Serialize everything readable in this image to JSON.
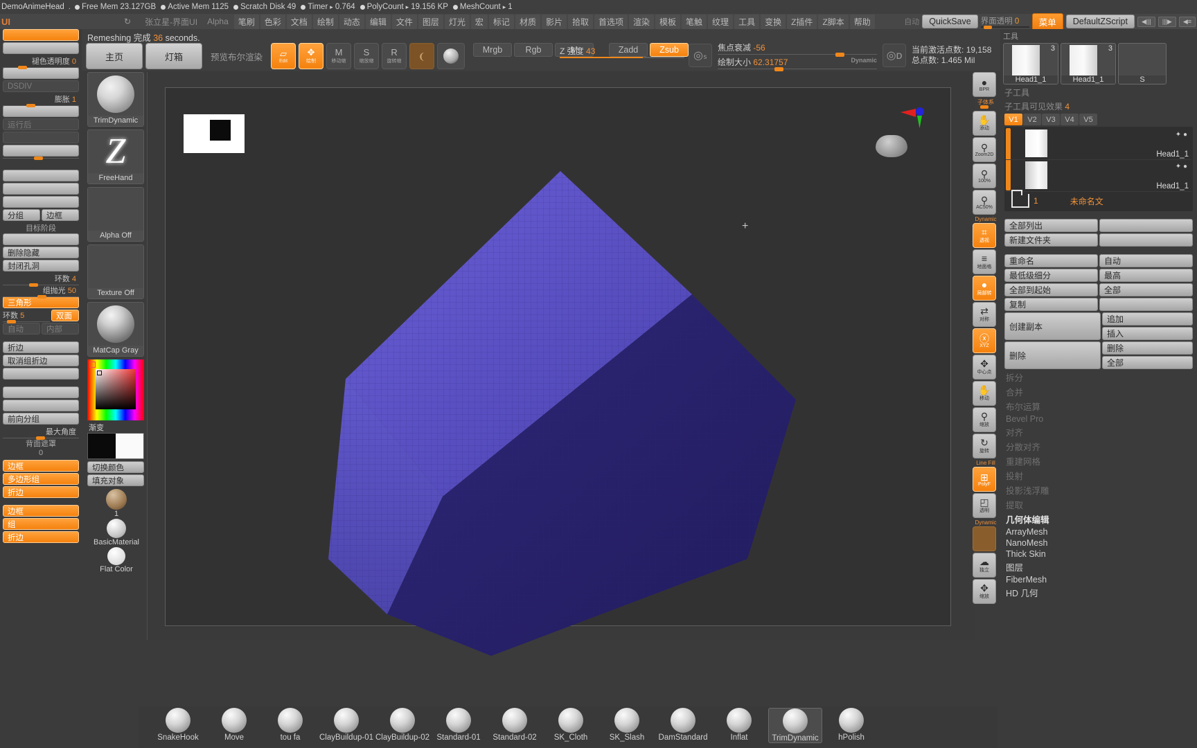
{
  "statusbar": {
    "title": "DemoAnimeHead",
    "dot_char": "●",
    "items": [
      {
        "label": "Free Mem",
        "value": "23.127GB"
      },
      {
        "label": "Active Mem",
        "value": "1125"
      },
      {
        "label": "Scratch Disk",
        "value": "49"
      },
      {
        "label": "Timer",
        "arrow": "▸",
        "value": "0.764"
      },
      {
        "label": "PolyCount",
        "arrow": "▸",
        "value": "19.156 KP"
      },
      {
        "label": "MeshCount",
        "arrow": "▸",
        "value": "1"
      }
    ]
  },
  "menubar": {
    "ui_tag": "UI",
    "reload_icon": "↻",
    "items": [
      "张立星-界面UI",
      "Alpha",
      "笔刷",
      "色彩",
      "文档",
      "绘制",
      "动态",
      "编辑",
      "文件",
      "图层",
      "灯光",
      "宏",
      "标记",
      "材质",
      "影片",
      "拾取",
      "首选项",
      "渲染",
      "模板",
      "笔触",
      "纹理",
      "工具",
      "变换",
      "Z插件",
      "Z脚本",
      "帮助"
    ],
    "auto_label": "自动",
    "quicksave": "QuickSave",
    "ui_transparency_label": "界面透明",
    "ui_transparency_value": "0",
    "menu_button": "菜单",
    "zscript": "DefaultZScript"
  },
  "shelf": {
    "status_text_prefix": "Remeshing ",
    "status_text_cn": "完成 ",
    "status_seconds": "36",
    "status_suffix": " seconds.",
    "home": "主页",
    "lightbox": "灯箱",
    "preview_bool": "预览布尔渲染",
    "edit_label": "Edit",
    "draw_label": "绘制",
    "move_label": "移动缩",
    "scale_label": "缩放缩",
    "rotate_label": "旋转缩",
    "move_glyph": "M",
    "scale_glyph": "S",
    "rotate_glyph": "R",
    "mrgb": "Mrgb",
    "rgb": "Rgb",
    "m": "M",
    "zadd": "Zadd",
    "zsub": "Zsub",
    "z_intensity_label": "Z 强度",
    "z_intensity_value": "43",
    "focal_shift_label": "焦点衰减",
    "focal_shift_value": "-56",
    "draw_size_label": "绘制大小",
    "draw_size_value": "62.31757",
    "dynamic_label": "Dynamic",
    "active_points_label": "当前激活点数:",
    "active_points_value": "19,158",
    "total_points_label": "总点数:",
    "total_points_value": "1.465 Mil"
  },
  "left_panel": {
    "rows": [
      {
        "type": "btn",
        "label": "",
        "state": "on"
      },
      {
        "type": "btn",
        "label": "",
        "state": "off"
      },
      {
        "type": "slider",
        "label": "褪色透明度",
        "value": "0",
        "knob": 22
      },
      {
        "type": "btn",
        "label": "",
        "state": "off"
      },
      {
        "type": "btn",
        "label": "DSDIV",
        "state": "ghost"
      },
      {
        "type": "slider",
        "label": "膨胀",
        "value": "1",
        "knob": 34
      },
      {
        "type": "btn",
        "label": "",
        "state": "off"
      },
      {
        "type": "btn",
        "label": "运行后",
        "state": "ghost"
      },
      {
        "type": "btn",
        "label": "",
        "state": "ghost"
      },
      {
        "type": "btn",
        "label": "",
        "state": "off"
      },
      {
        "type": "slider",
        "label": "",
        "value": "",
        "knob": 45
      },
      {
        "type": "btn",
        "label": "",
        "state": "off"
      },
      {
        "type": "btn",
        "label": "",
        "state": "off"
      },
      {
        "type": "btn",
        "label": "",
        "state": "off"
      },
      {
        "type": "pair",
        "a": "分组",
        "b": "边框"
      },
      {
        "type": "sect",
        "label": "目标阶段"
      },
      {
        "type": "btn",
        "label": "",
        "state": "off"
      },
      {
        "type": "btn",
        "label": "删除隐藏",
        "state": "off"
      },
      {
        "type": "btn",
        "label": "封闭孔洞",
        "state": "off"
      },
      {
        "type": "slider",
        "label": "环数",
        "value": "4",
        "knob": 38
      },
      {
        "type": "slider",
        "label": "组抛光",
        "value": "50",
        "knob": 50
      },
      {
        "type": "btn",
        "label": "三角形",
        "state": "on"
      },
      {
        "type": "pairslider",
        "label": "环数",
        "value": "5",
        "b": "双面"
      },
      {
        "type": "pair",
        "a": "自动",
        "b": "内部",
        "dim": true
      },
      {
        "type": "gap"
      },
      {
        "type": "btn",
        "label": "折边",
        "state": "off"
      },
      {
        "type": "btn",
        "label": "取消组折边",
        "state": "off"
      },
      {
        "type": "btn",
        "label": "",
        "state": "off"
      },
      {
        "type": "gap"
      },
      {
        "type": "btn",
        "label": "",
        "state": "off"
      },
      {
        "type": "btn",
        "label": "",
        "state": "off"
      },
      {
        "type": "btn",
        "label": "前向分组",
        "state": "off"
      },
      {
        "type": "slider",
        "label": "最大角度",
        "value": "",
        "knob": 48
      },
      {
        "type": "sect",
        "label": "背面遮罩"
      },
      {
        "type": "sect",
        "label": "0"
      },
      {
        "type": "btn",
        "label": "边框",
        "state": "on"
      },
      {
        "type": "btn",
        "label": "多边形组",
        "state": "on"
      },
      {
        "type": "btn",
        "label": "折边",
        "state": "on"
      },
      {
        "type": "gap"
      },
      {
        "type": "btn",
        "label": "边框",
        "state": "on"
      },
      {
        "type": "btn",
        "label": "组",
        "state": "on"
      },
      {
        "type": "btn",
        "label": "折边",
        "state": "on"
      }
    ]
  },
  "tool_column": {
    "brush": {
      "label": "TrimDynamic",
      "icon": "sphere-brush-icon"
    },
    "stroke": {
      "label": "FreeHand",
      "icon": "freehand-stroke-icon"
    },
    "alpha": {
      "label": "Alpha Off",
      "icon": "alpha-off-icon"
    },
    "texture": {
      "label": "Texture Off",
      "icon": "texture-off-icon"
    },
    "material": {
      "label": "MatCap Gray",
      "icon": "matcap-sphere-icon"
    },
    "gradient_label": "渐变",
    "switch_color": "切换颜色",
    "fill_object": "填充对象",
    "material_number": "1",
    "basic_material": "BasicMaterial",
    "flat_color": "Flat Color"
  },
  "canvas": {
    "cursor": "+",
    "gizmo_axes": [
      "x-axis-red",
      "y-axis-green",
      "z-axis-blue"
    ]
  },
  "rail": {
    "sublabel_top": "子体系",
    "items": [
      {
        "name": "bpr-render",
        "glyph": "●",
        "cap": "BPR",
        "state": "off"
      },
      {
        "name": "move-view",
        "glyph": "✋",
        "cap": "添动",
        "state": "off"
      },
      {
        "name": "zoom2d",
        "glyph": "⚲",
        "cap": "Zoom2D",
        "state": "off"
      },
      {
        "name": "actual-size",
        "glyph": "⚲",
        "cap": "100%",
        "state": "off"
      },
      {
        "name": "aa-half",
        "glyph": "⚲",
        "cap": "AC50%",
        "state": "off"
      },
      {
        "name": "persp",
        "glyph": "⌗",
        "cap": "透视",
        "state": "on",
        "toplabel": "Dynamic"
      },
      {
        "name": "floor-grid",
        "glyph": "≡",
        "cap": "地面格",
        "state": "off"
      },
      {
        "name": "local-symmetry",
        "glyph": "●",
        "cap": "局部转",
        "state": "on"
      },
      {
        "name": "symmetry",
        "glyph": "⇄",
        "cap": "对称",
        "state": "off"
      },
      {
        "name": "xyz-axis",
        "glyph": "ⓧ",
        "cap": "XYZ",
        "state": "on"
      },
      {
        "name": "center-point",
        "glyph": "✥",
        "cap": "中心点",
        "state": "off"
      },
      {
        "name": "move-gizmo",
        "glyph": "✋",
        "cap": "移动",
        "state": "off"
      },
      {
        "name": "scale-gizmo",
        "glyph": "⚲",
        "cap": "缩放",
        "state": "off"
      },
      {
        "name": "rotate-gizmo",
        "glyph": "↻",
        "cap": "旋转",
        "state": "off"
      },
      {
        "name": "polyframe",
        "glyph": "⊞",
        "cap": "PolyF",
        "state": "on",
        "toplabel": "Line Fill"
      },
      {
        "name": "transparency",
        "glyph": "◰",
        "cap": "透明",
        "state": "off"
      },
      {
        "name": "ghost",
        "glyph": "",
        "cap": "",
        "state": "amber",
        "toplabel": "Dynamic"
      },
      {
        "name": "solo",
        "glyph": "☁",
        "cap": "独立",
        "state": "off"
      },
      {
        "name": "frame",
        "glyph": "✥",
        "cap": "缩放",
        "state": "off"
      }
    ]
  },
  "right_tray": {
    "tool_header": "工具",
    "tool_thumbs": [
      {
        "name": "Head1_1",
        "num": "3"
      },
      {
        "name": "Head1_1",
        "num": "3"
      },
      {
        "name": "S",
        "num": ""
      }
    ],
    "subtool_label": "子工具",
    "subtool_vis_label": "子工具可见效果",
    "vtabs": [
      "V1",
      "V2",
      "V3",
      "V4",
      "V5"
    ],
    "subtools": [
      {
        "name": "Head1_1"
      },
      {
        "name": "Head1_1"
      }
    ],
    "folder_count": "1",
    "folder_name": "未命名文",
    "buttons_a": [
      [
        "全部列出",
        ""
      ],
      [
        "新建文件夹",
        ""
      ]
    ],
    "buttons_b": [
      [
        "重命名",
        "自动"
      ],
      [
        "最低级细分",
        "最高"
      ],
      [
        "全部到起始",
        "全部"
      ],
      [
        "复制",
        ""
      ],
      [
        "创建副本",
        "追加"
      ],
      [
        "",
        "插入"
      ],
      [
        "删除",
        "删除"
      ],
      [
        "",
        "全部"
      ]
    ],
    "dim_items": [
      "拆分",
      "合并",
      "布尔运算",
      "Bevel Pro",
      "对齐",
      "分散对齐",
      "重建网格",
      "投射",
      "投影浅浮雕",
      "提取"
    ],
    "geo_items": [
      "几何体编辑",
      "ArrayMesh",
      "NanoMesh",
      "Thick Skin",
      "图层",
      "FiberMesh",
      "HD 几何"
    ]
  },
  "bottom_brushes": [
    {
      "label": "SnakeHook",
      "selected": false
    },
    {
      "label": "Move",
      "selected": false
    },
    {
      "label": "tou fa",
      "selected": false
    },
    {
      "label": "ClayBuildup-01",
      "selected": false
    },
    {
      "label": "ClayBuildup-02",
      "selected": false
    },
    {
      "label": "Standard-01",
      "selected": false
    },
    {
      "label": "Standard-02",
      "selected": false
    },
    {
      "label": "SK_Cloth",
      "selected": false
    },
    {
      "label": "SK_Slash",
      "selected": false
    },
    {
      "label": "DamStandard",
      "selected": false
    },
    {
      "label": "Inflat",
      "selected": false
    },
    {
      "label": "TrimDynamic",
      "selected": true
    },
    {
      "label": "hPolish",
      "selected": false
    }
  ],
  "colors": {
    "accent": "#f5820e",
    "panel": "#3b3b3b",
    "button": "#c0c0c0",
    "mesh_light": "#5a52c8",
    "mesh_dark": "#2b2470"
  }
}
